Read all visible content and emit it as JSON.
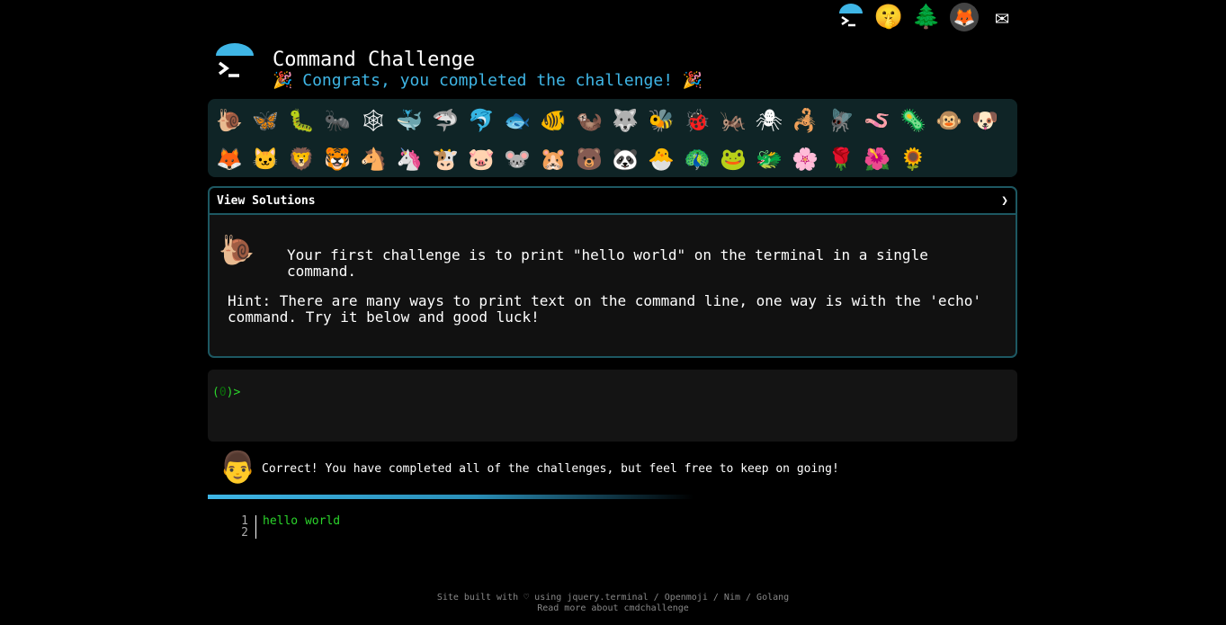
{
  "topnav": {
    "icons": [
      {
        "name": "cmd-logo-icon"
      },
      {
        "name": "shush-face-icon",
        "glyph": "🤫"
      },
      {
        "name": "tree-icon",
        "glyph": "🌲"
      },
      {
        "name": "gitlab-icon",
        "glyph": "🦊"
      },
      {
        "name": "mail-icon",
        "glyph": "✉"
      }
    ]
  },
  "header": {
    "title": "Command Challenge",
    "subtitle": "🎉 Congrats, you completed the challenge! 🎉"
  },
  "emoji_bar": {
    "row1": [
      "🐌",
      "🦋",
      "🐛",
      "🐜",
      "🕸",
      "🐳",
      "🦈",
      "🐬",
      "🐟",
      "🐠",
      "🦦",
      "🐺",
      "🐝",
      "🐞",
      "🦗",
      "🕷",
      "🦂",
      "🪰",
      "🪱",
      "🦠",
      "🐵",
      "🐶"
    ],
    "row2": [
      "🦊",
      "🐱",
      "🦁",
      "🐯",
      "🐴",
      "🦄",
      "🐮",
      "🐷",
      "🐭",
      "🐹",
      "🐻",
      "🐼",
      "🐣",
      "🦚",
      "🐸",
      "🐲",
      "🌸",
      "🌹",
      "🌺",
      "🌻"
    ]
  },
  "challenge": {
    "solutions_label": "View Solutions",
    "chevron": "❯",
    "icon_glyph": "🐌",
    "description": "Your first challenge is to print \"hello world\" on the terminal in a single command.",
    "hint": "Hint: There are many ways to print text on the command line, one way is with the 'echo' command. Try it below and good luck!"
  },
  "terminal": {
    "prompt_open": "(",
    "prompt_count": "0",
    "prompt_close": ")>"
  },
  "result": {
    "icon_glyph": "👨",
    "message": "Correct! You have completed all of the challenges, but feel free to keep on going!"
  },
  "output": {
    "lines": [
      {
        "num": "1",
        "text": "hello world"
      },
      {
        "num": "2",
        "text": ""
      }
    ]
  },
  "footer": {
    "line1_prefix": "Site built with ♡ using ",
    "link_jquery": "jquery.terminal",
    "sep1": " / ",
    "link_openmoji": "Openmoji",
    "sep2": " / ",
    "link_nim": "Nim",
    "sep3": " / ",
    "link_golang": "Golang",
    "line2": "Read more about cmdchallenge"
  },
  "colors": {
    "accent": "#3fb6e6",
    "terminal_green": "#2bd52b",
    "border_teal": "#1d5862"
  }
}
